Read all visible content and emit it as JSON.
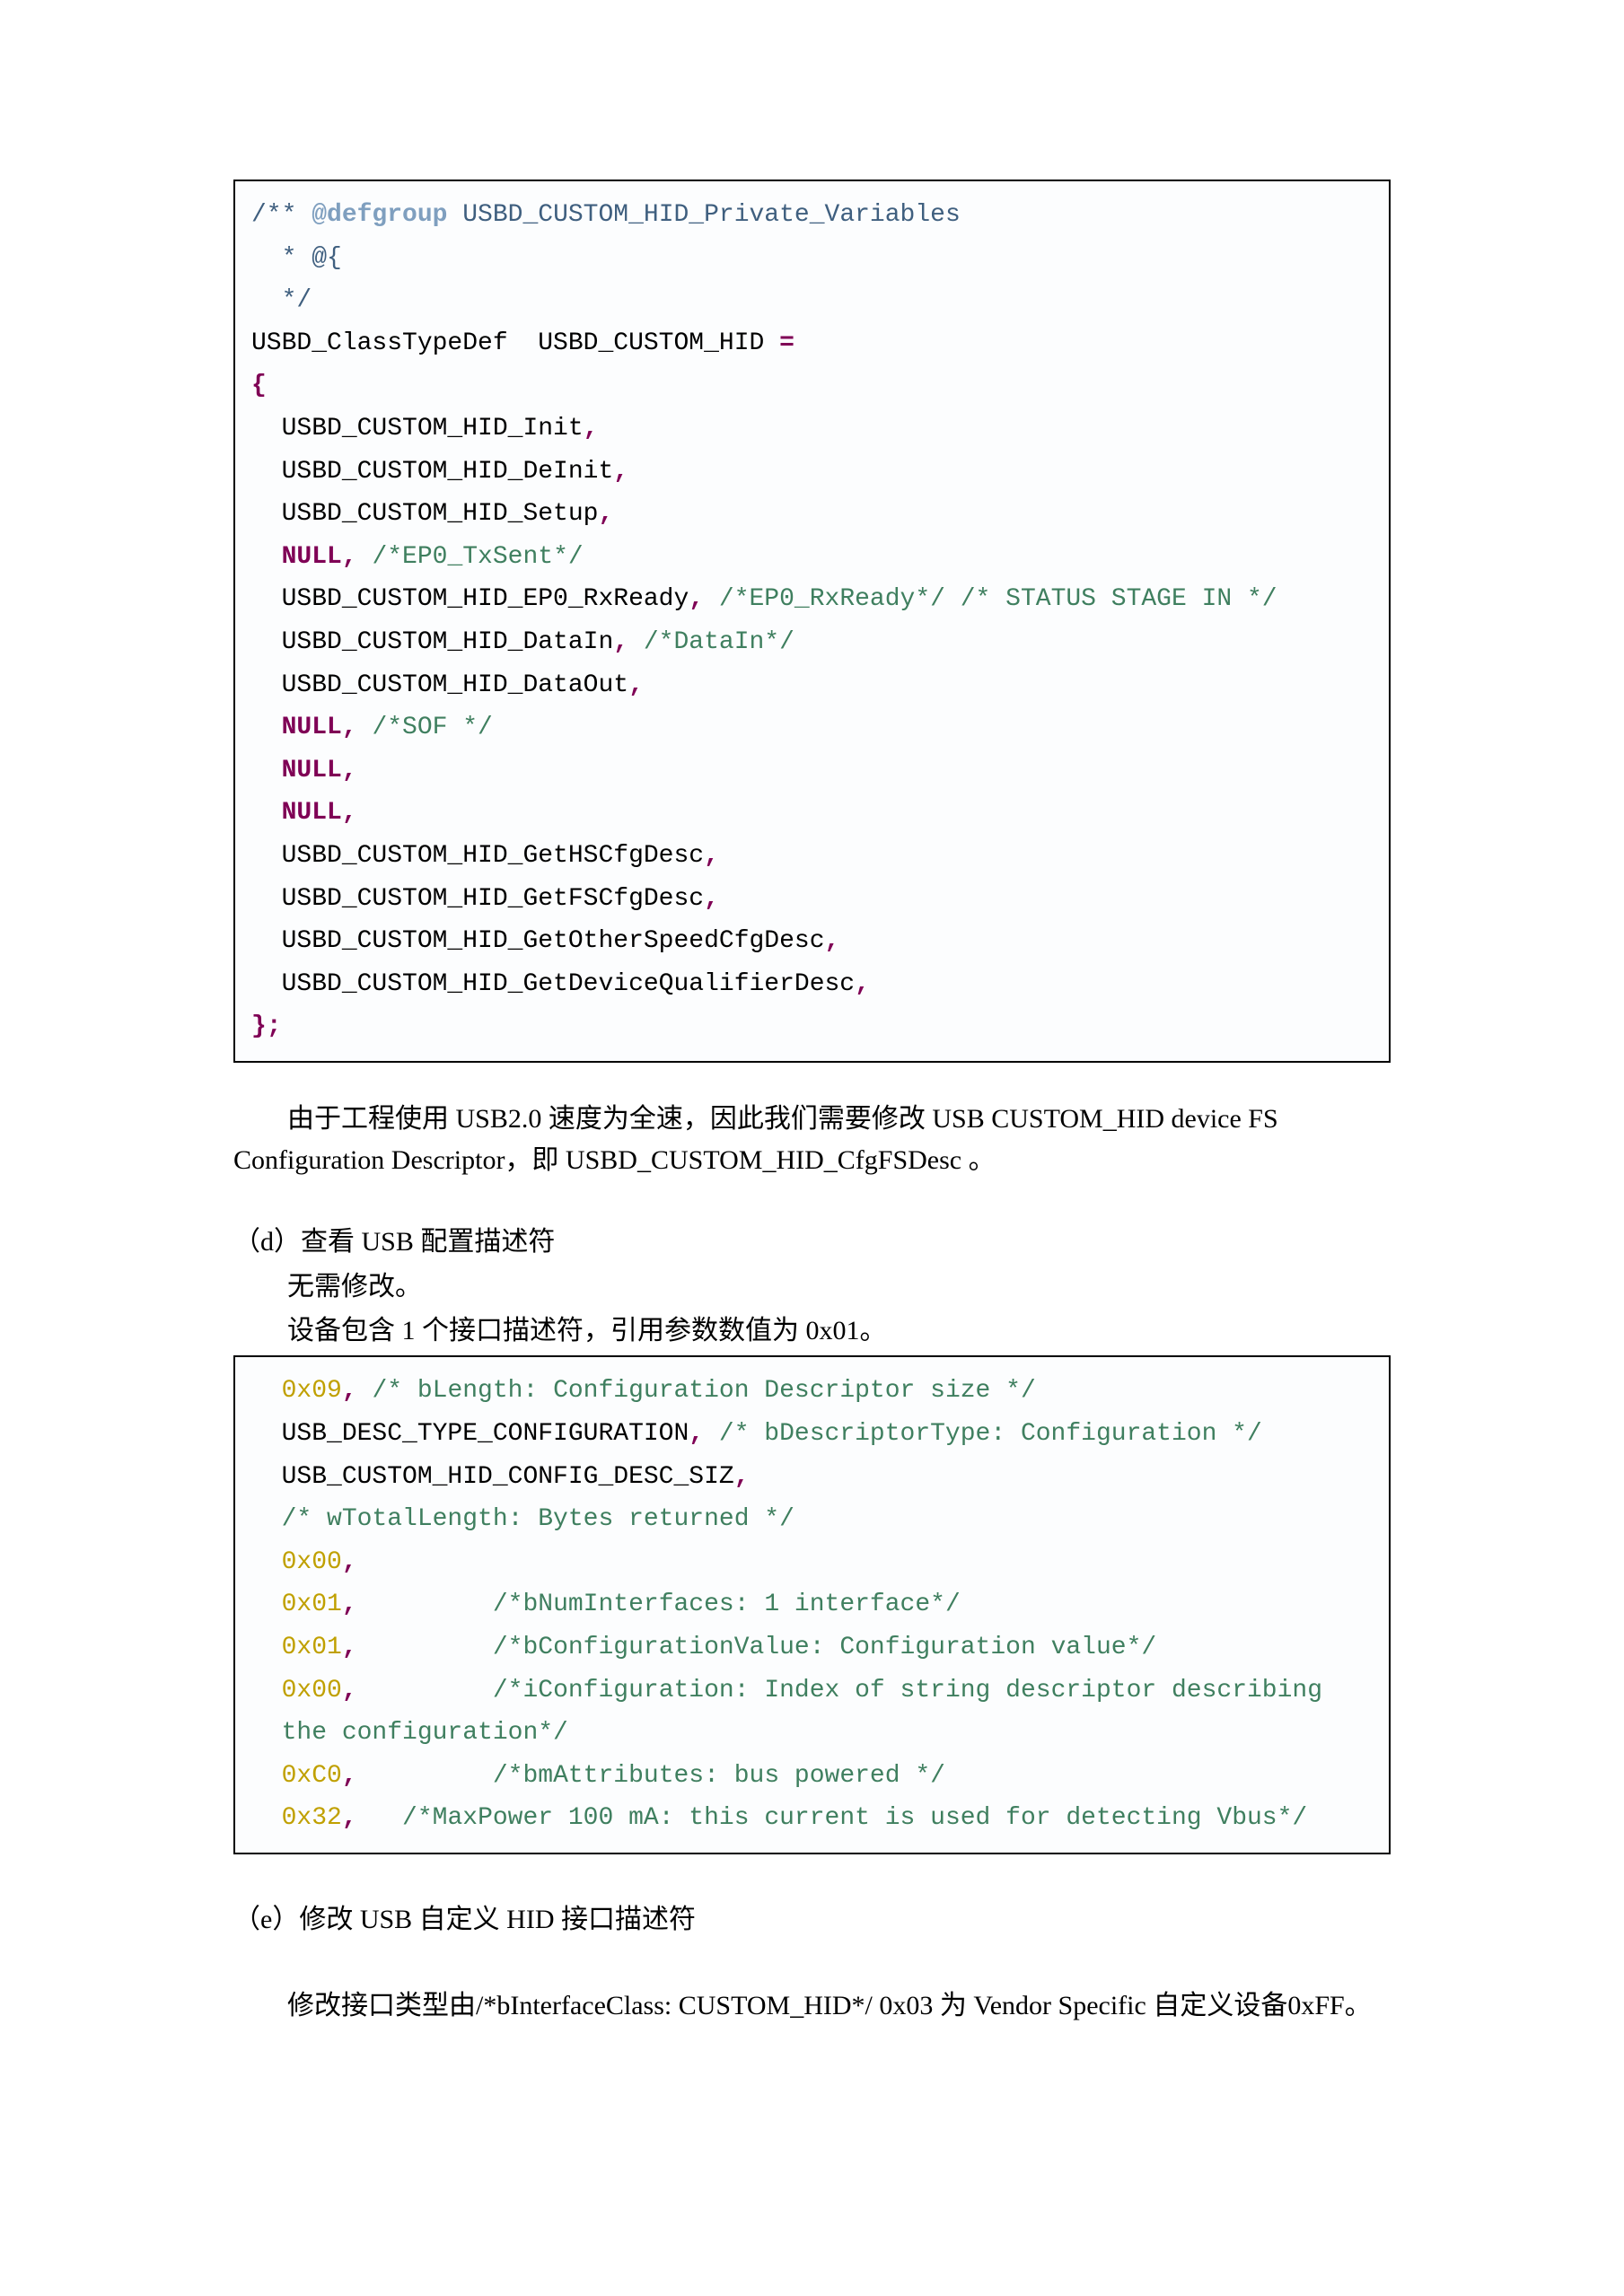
{
  "code1": {
    "l1a": "/** ",
    "l1b": "@defgroup",
    "l1c": " USBD_CUSTOM_HID_Private_Variables",
    "l2": "  * @{",
    "l3": "  */",
    "l4a": "USBD_ClassTypeDef  USBD_CUSTOM_HID ",
    "l4b": "=",
    "l5": "{",
    "l6a": "  USBD_CUSTOM_HID_Init",
    "l6b": ",",
    "l7a": "  USBD_CUSTOM_HID_DeInit",
    "l7b": ",",
    "l8a": "  USBD_CUSTOM_HID_Setup",
    "l8b": ",",
    "l9a": "  ",
    "l9b": "NULL",
    "l9c": ", ",
    "l9d": "/*EP0_TxSent*/",
    "l10a": "  USBD_CUSTOM_HID_EP0_RxReady",
    "l10b": ", ",
    "l10c": "/*EP0_RxReady*/",
    "l10d": " ",
    "l10e": "/* STATUS STAGE IN */",
    "l11a": "  USBD_CUSTOM_HID_DataIn",
    "l11b": ", ",
    "l11c": "/*DataIn*/",
    "l12a": "  USBD_CUSTOM_HID_DataOut",
    "l12b": ",",
    "l13a": "  ",
    "l13b": "NULL",
    "l13c": ", ",
    "l13d": "/*SOF */",
    "l14a": "  ",
    "l14b": "NULL",
    "l14c": ",",
    "l15a": "  ",
    "l15b": "NULL",
    "l15c": ",",
    "l16a": "  USBD_CUSTOM_HID_GetHSCfgDesc",
    "l16b": ",",
    "l17a": "  USBD_CUSTOM_HID_GetFSCfgDesc",
    "l17b": ",",
    "l18a": "  USBD_CUSTOM_HID_GetOtherSpeedCfgDesc",
    "l18b": ",",
    "l19a": "  USBD_CUSTOM_HID_GetDeviceQualifierDesc",
    "l19b": ",",
    "l20": "};"
  },
  "para1": "由于工程使用 USB2.0 速度为全速，因此我们需要修改 USB CUSTOM_HID device FS Configuration Descriptor，即 USBD_CUSTOM_HID_CfgFSDesc 。",
  "headD": "（d）查看 USB 配置描述符",
  "sub1": "无需修改。",
  "sub2": "设备包含 1 个接口描述符，引用参数数值为 0x01。",
  "code2": {
    "l1a": "  ",
    "l1b": "0x09",
    "l1c": ", ",
    "l1d": "/* bLength: Configuration Descriptor size */",
    "l2a": "  USB_DESC_TYPE_CONFIGURATION",
    "l2b": ", ",
    "l2c": "/* bDescriptorType: Configuration */",
    "l3a": "  USB_CUSTOM_HID_CONFIG_DESC_SIZ",
    "l3b": ",",
    "l4": "  /* wTotalLength: Bytes returned */",
    "l5a": "  ",
    "l5b": "0x00",
    "l5c": ",",
    "l6a": "  ",
    "l6b": "0x01",
    "l6c": ",",
    "l6d": "         /*bNumInterfaces: 1 interface*/",
    "l7a": "  ",
    "l7b": "0x01",
    "l7c": ",",
    "l7d": "         /*bConfigurationValue: Configuration value*/",
    "l8a": "  ",
    "l8b": "0x00",
    "l8c": ",",
    "l8d": "         /*iConfiguration: Index of string descriptor describing",
    "l9": "  the configuration*/",
    "l10a": "  ",
    "l10b": "0xC0",
    "l10c": ",",
    "l10d": "         /*bmAttributes: bus powered */",
    "l11a": "  ",
    "l11b": "0x32",
    "l11c": ",",
    "l11d": "   /*MaxPower 100 mA: this current is used for detecting Vbus*/"
  },
  "headE": "（e）修改 USB 自定义 HID 接口描述符",
  "para2": "修改接口类型由/*bInterfaceClass: CUSTOM_HID*/ 0x03 为 Vendor Specific 自定义设备0xFF。"
}
